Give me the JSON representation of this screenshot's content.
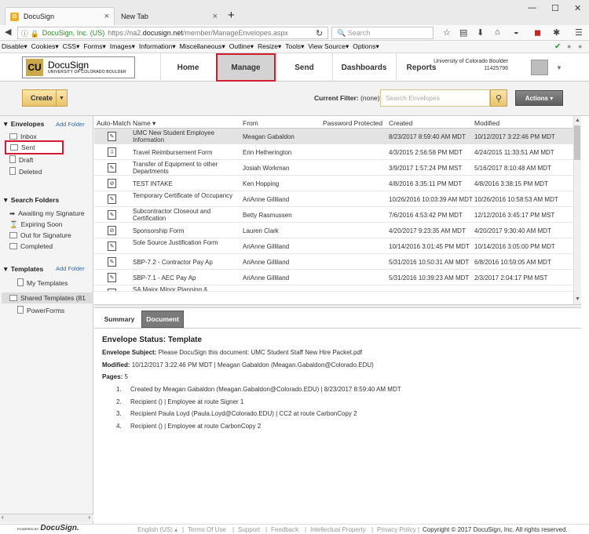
{
  "browser": {
    "tabs": [
      {
        "label": "DocuSign",
        "close": "×"
      },
      {
        "label": "New Tab",
        "close": "×"
      }
    ],
    "new_tab": "+",
    "window": {
      "minimize": "—",
      "maximize": "☐",
      "close": "✕"
    },
    "address": {
      "site": "DocuSign, Inc. (US)",
      "url_pre": "https://na2.",
      "url_domain": "docusign.net",
      "url_post": "/member/ManageEnvelopes.aspx"
    },
    "search_placeholder": "Search",
    "bookmarks": [
      "Disable▾",
      "Cookies▾",
      "CSS▾",
      "Forms▾",
      "Images▾",
      "Information▾",
      "Miscellaneous▾",
      "Outline▾",
      "Resize▾",
      "Tools▾",
      "View Source▾",
      "Options▾"
    ]
  },
  "header": {
    "logo_title": "DocuSign",
    "logo_sub": "UNIVERSITY OF COLORADO BOULDER",
    "nav": [
      "Home",
      "Manage",
      "Send",
      "Dashboards",
      "Reports"
    ],
    "account_name": "University of Colorado Boulder",
    "account_id": "11425796"
  },
  "toolbar": {
    "create": "Create",
    "filter_label": "Current Filter:",
    "filter_value": "(none)",
    "search_placeholder": "Search Envelopes",
    "actions": "Actions ▾"
  },
  "sidebar": {
    "envelopes_title": "Envelopes",
    "add_folder": "Add Folder",
    "envelopes": [
      "Inbox",
      "Sent",
      "Draft",
      "Deleted"
    ],
    "search_title": "Search Folders",
    "search_folders": [
      "Awaiting my Signature",
      "Expiring Soon",
      "Out for Signature",
      "Completed"
    ],
    "templates_title": "Templates",
    "templates_add": "Add Folder",
    "templates": [
      "My Templates",
      "Shared Templates (81",
      "PowerForms"
    ]
  },
  "grid": {
    "columns": [
      "Auto-Match",
      "Name ▾",
      "From",
      "Password Protected",
      "Created",
      "Modified"
    ],
    "rows": [
      {
        "name": "UMC New Student Employee Information",
        "from": "Meagan Gabaldon",
        "created": "8/23/2017 8:59:40 AM MDT",
        "modified": "10/12/2017 3:22:46 PM MDT"
      },
      {
        "name": "Travel Reimbursement Form",
        "from": "Erin Hetherington",
        "created": "4/3/2015 2:56:58 PM MDT",
        "modified": "4/24/2015 11:33:51 AM MDT"
      },
      {
        "name": "Transfer of Equipment to other Departments",
        "from": "Josiah Workman",
        "created": "3/9/2017 1:57:24 PM MST",
        "modified": "5/16/2017 8:10:48 AM MDT"
      },
      {
        "name": "TEST INTAKE",
        "from": "Ken Hopping",
        "created": "4/8/2016 3:35:11 PM MDT",
        "modified": "4/8/2016 3:38:15 PM MDT"
      },
      {
        "name": "Temporary Certificate of Occupancy",
        "from": "AriAnne Gilliland",
        "created": "10/26/2016 10:03:39 AM MDT",
        "modified": "10/26/2016 10:58:53 AM MDT"
      },
      {
        "name": "Subcontractor Closeout and Certification",
        "from": "Betty Rasmussen",
        "created": "7/6/2016 4:53:42 PM MDT",
        "modified": "12/12/2016 3:45:17 PM MST"
      },
      {
        "name": "Sponsorship Form",
        "from": "Lauren Clark",
        "created": "4/20/2017 9:23:35 AM MDT",
        "modified": "4/20/2017 9:30:40 AM MDT"
      },
      {
        "name": "Sole Source Justification Form",
        "from": "AriAnne Gilliland",
        "created": "10/14/2016 3:01:45 PM MDT",
        "modified": "10/14/2016 3:05:00 PM MDT"
      },
      {
        "name": "SBP-7.2 - Contractor Pay Ap",
        "from": "AriAnne Gilliland",
        "created": "5/31/2016 10:50:31 AM MDT",
        "modified": "6/8/2016 10:59:05 AM MDT"
      },
      {
        "name": "SBP-7.1 - AEC Pay Ap",
        "from": "AriAnne Gilliland",
        "created": "5/31/2016 10:39:23 AM MDT",
        "modified": "2/3/2017 2:04:17 PM MST"
      },
      {
        "name": "SA Major Minor Planning & Evaluation",
        "from": "",
        "created": "",
        "modified": ""
      }
    ]
  },
  "detail": {
    "tabs": [
      "Summary",
      "Document"
    ],
    "title": "Envelope Status: Template",
    "subject_label": "Envelope Subject:",
    "subject": "Please DocuSign this document: UMC Student Staff New Hire Packet.pdf",
    "modified_label": "Modified:",
    "modified": "10/12/2017 3:22:46 PM MDT | Meagan Gabaldon (Meagan.Gabaldon@Colorado.EDU)",
    "pages_label": "Pages:",
    "pages": "5",
    "history": [
      "Created by Meagan Gabaldon (Meagan.Gabaldon@Colorado.EDU) | 8/23/2017 8:59:40 AM MDT",
      "Recipient () | Employee at route Signer 1",
      "Recipient Paula Loyd (Paula.Loyd@Colorado.EDU) | CC2 at route CarbonCopy 2",
      "Recipient () | Employee at route CarbonCopy 2"
    ]
  },
  "footer": {
    "powered_by": "POWERED BY",
    "brand": "DocuSign.",
    "links": [
      "English (US) ▴",
      "Terms Of Use",
      "Support",
      "Feedback",
      "Intellectual Property",
      "Privacy Policy"
    ],
    "copyright": "Copyright © 2017 DocuSign, Inc. All rights reserved."
  }
}
